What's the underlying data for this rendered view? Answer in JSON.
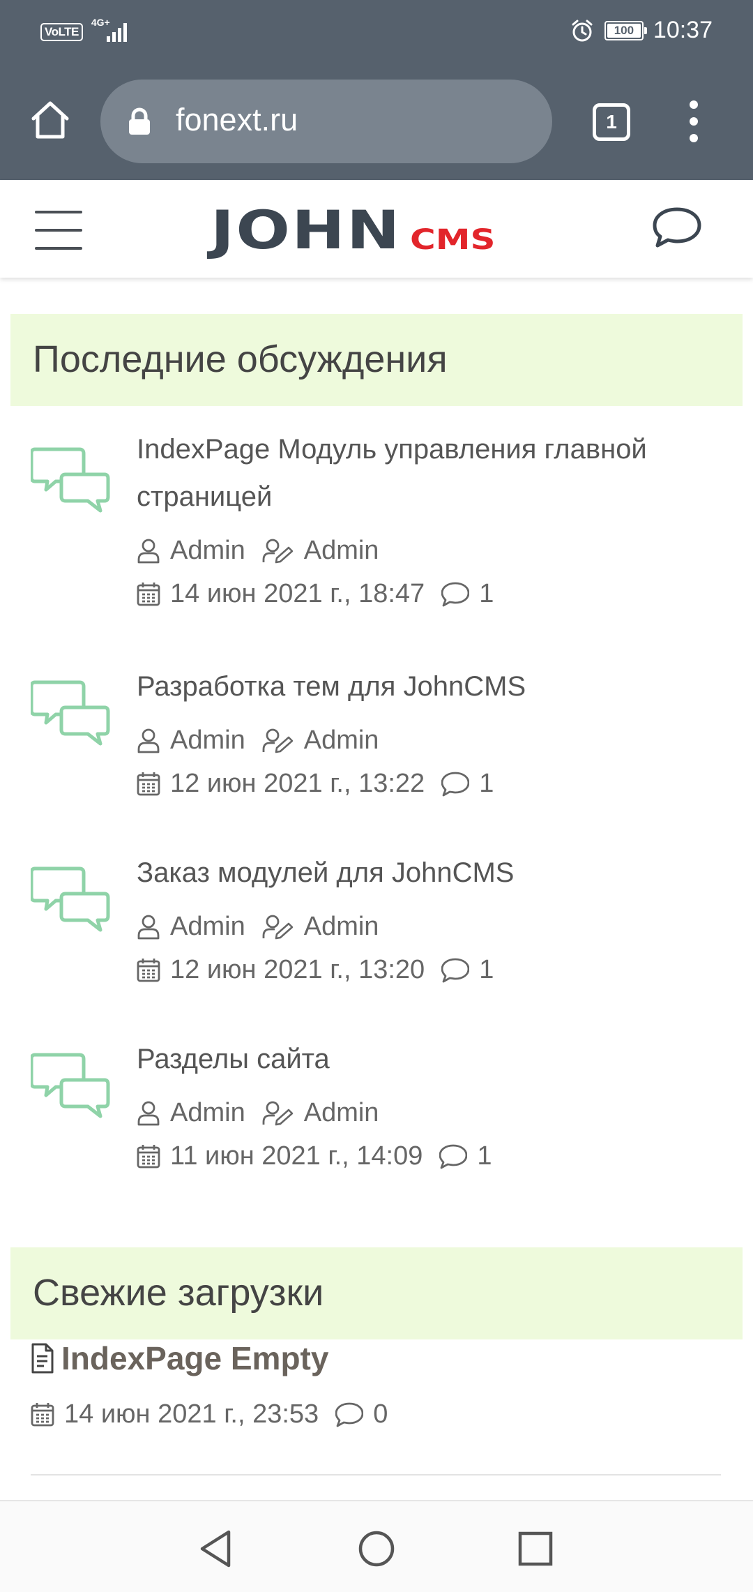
{
  "status_bar": {
    "volte": "VoLTE",
    "network": "4G+",
    "battery": "100",
    "time": "10:37"
  },
  "browser": {
    "url": "fonext.ru",
    "tab_count": "1"
  },
  "site": {
    "logo_main": "JOHN",
    "logo_sub": "CMS"
  },
  "discussions": {
    "heading": "Последние обсуждения",
    "topics": [
      {
        "title": "IndexPage Модуль управления главной страницей",
        "author": "Admin",
        "last_poster": "Admin",
        "date": "14 июн 2021 г., 18:47",
        "replies": "1"
      },
      {
        "title": "Разработка тем для JohnCMS",
        "author": "Admin",
        "last_poster": "Admin",
        "date": "12 июн 2021 г., 13:22",
        "replies": "1"
      },
      {
        "title": "Заказ модулей для JohnCMS",
        "author": "Admin",
        "last_poster": "Admin",
        "date": "12 июн 2021 г., 13:20",
        "replies": "1"
      },
      {
        "title": "Разделы сайта",
        "author": "Admin",
        "last_poster": "Admin",
        "date": "11 июн 2021 г., 14:09",
        "replies": "1"
      }
    ]
  },
  "downloads": {
    "heading": "Свежие загрузки",
    "items": [
      {
        "title": "IndexPage Empty",
        "date": "14 июн 2021 г., 23:53",
        "comments": "0"
      }
    ]
  },
  "colors": {
    "browser_chrome": "#56616d",
    "section_bg": "#eefadc",
    "topic_icon": "#8fd3a8",
    "logo_dark": "#3c4651",
    "logo_red": "#e2252b"
  },
  "icons": [
    "home-icon",
    "lock-icon",
    "tabs-icon",
    "more-vert-icon",
    "hamburger-icon",
    "chat-bubble-icon",
    "topic-chat-icon",
    "user-icon",
    "edit-user-icon",
    "calendar-icon",
    "comment-icon",
    "file-icon",
    "back-icon",
    "home-circle-icon",
    "recents-icon"
  ]
}
